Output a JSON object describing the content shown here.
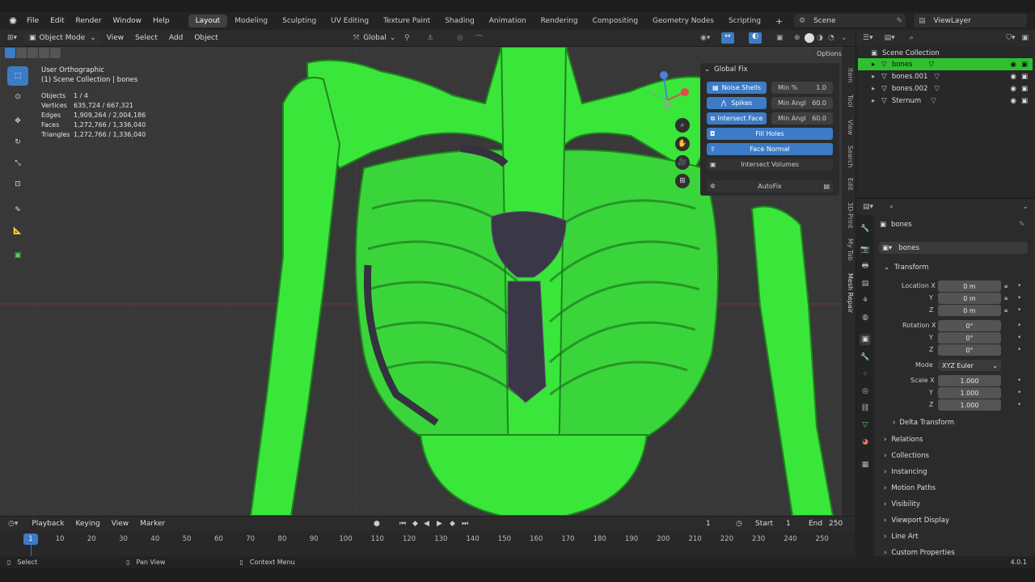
{
  "menu": [
    "File",
    "Edit",
    "Render",
    "Window",
    "Help"
  ],
  "workspaces": [
    "Layout",
    "Modeling",
    "Sculpting",
    "UV Editing",
    "Texture Paint",
    "Shading",
    "Animation",
    "Rendering",
    "Compositing",
    "Geometry Nodes",
    "Scripting"
  ],
  "active_workspace": "Layout",
  "scene_name": "Scene",
  "view_layer": "ViewLayer",
  "viewport_header": {
    "mode": "Object Mode",
    "items": [
      "View",
      "Select",
      "Add",
      "Object"
    ],
    "orientation": "Global",
    "options": "Options"
  },
  "overlay_text": {
    "view_name": "User Orthographic",
    "collection_line": "(1) Scene Collection | bones"
  },
  "stats": [
    {
      "label": "Objects",
      "value": "1 / 4"
    },
    {
      "label": "Vertices",
      "value": "635,724 / 667,321"
    },
    {
      "label": "Edges",
      "value": "1,909,264 / 2,004,186"
    },
    {
      "label": "Faces",
      "value": "1,272,766 / 1,336,040"
    },
    {
      "label": "Triangles",
      "value": "1,272,766 / 1,336,040"
    }
  ],
  "global_fix": {
    "title": "Global Fix",
    "noise_shells": "Noise Shells",
    "min_pct_label": "Min %",
    "min_pct_value": "1.0",
    "spikes": "Spikes",
    "min_angl_label": "Min Angl",
    "min_angl_value": "60.0",
    "intersect_face": "Intersect Face",
    "min_angl2_label": "Min Angl",
    "min_angl2_value": "60.0",
    "fill_holes": "Fill Holes",
    "face_normal": "Face Normal",
    "intersect_volumes": "Intersect Volumes",
    "autofix": "AutoFix"
  },
  "sidebar_tabs": [
    "Item",
    "Tool",
    "View",
    "Search",
    "Edit",
    "3D-Print",
    "My Tab",
    "Mesh Repair"
  ],
  "outliner": {
    "root": "Scene Collection",
    "items": [
      {
        "name": "bones",
        "selected": true
      },
      {
        "name": "bones.001",
        "selected": false
      },
      {
        "name": "bones.002",
        "selected": false
      },
      {
        "name": "Sternum",
        "selected": false
      }
    ]
  },
  "properties": {
    "object_name": "bones",
    "data_name": "bones",
    "transform_label": "Transform",
    "location_label": "Location X",
    "location": [
      "0 m",
      "0 m",
      "0 m"
    ],
    "rotation_label": "Rotation X",
    "rotation": [
      "0°",
      "0°",
      "0°"
    ],
    "mode_label": "Mode",
    "mode_value": "XYZ Euler",
    "scale_label": "Scale X",
    "scale": [
      "1.000",
      "1.000",
      "1.000"
    ],
    "y_label": "Y",
    "z_label": "Z",
    "delta_transform": "Delta Transform",
    "panels": [
      "Relations",
      "Collections",
      "Instancing",
      "Motion Paths",
      "Visibility",
      "Viewport Display",
      "Line Art",
      "Custom Properties"
    ]
  },
  "timeline": {
    "menus": [
      "Playback",
      "Keying",
      "View",
      "Marker"
    ],
    "current_frame": "1",
    "current_frame_display": "1",
    "start_label": "Start",
    "start": "1",
    "end_label": "End",
    "end": "250",
    "ticks": [
      "10",
      "20",
      "30",
      "40",
      "50",
      "60",
      "70",
      "80",
      "90",
      "100",
      "110",
      "120",
      "130",
      "140",
      "150",
      "160",
      "170",
      "180",
      "190",
      "200",
      "210",
      "220",
      "230",
      "240",
      "250"
    ]
  },
  "statusbar": {
    "select": "Select",
    "pan": "Pan View",
    "context": "Context Menu",
    "version": "4.0.1"
  },
  "colors": {
    "accent": "#3c7cc7",
    "selection_green": "#2fbf2f",
    "bone_green": "#3dff3d",
    "viewport_bg": "#383838",
    "panel_bg": "#2b2b2b"
  }
}
